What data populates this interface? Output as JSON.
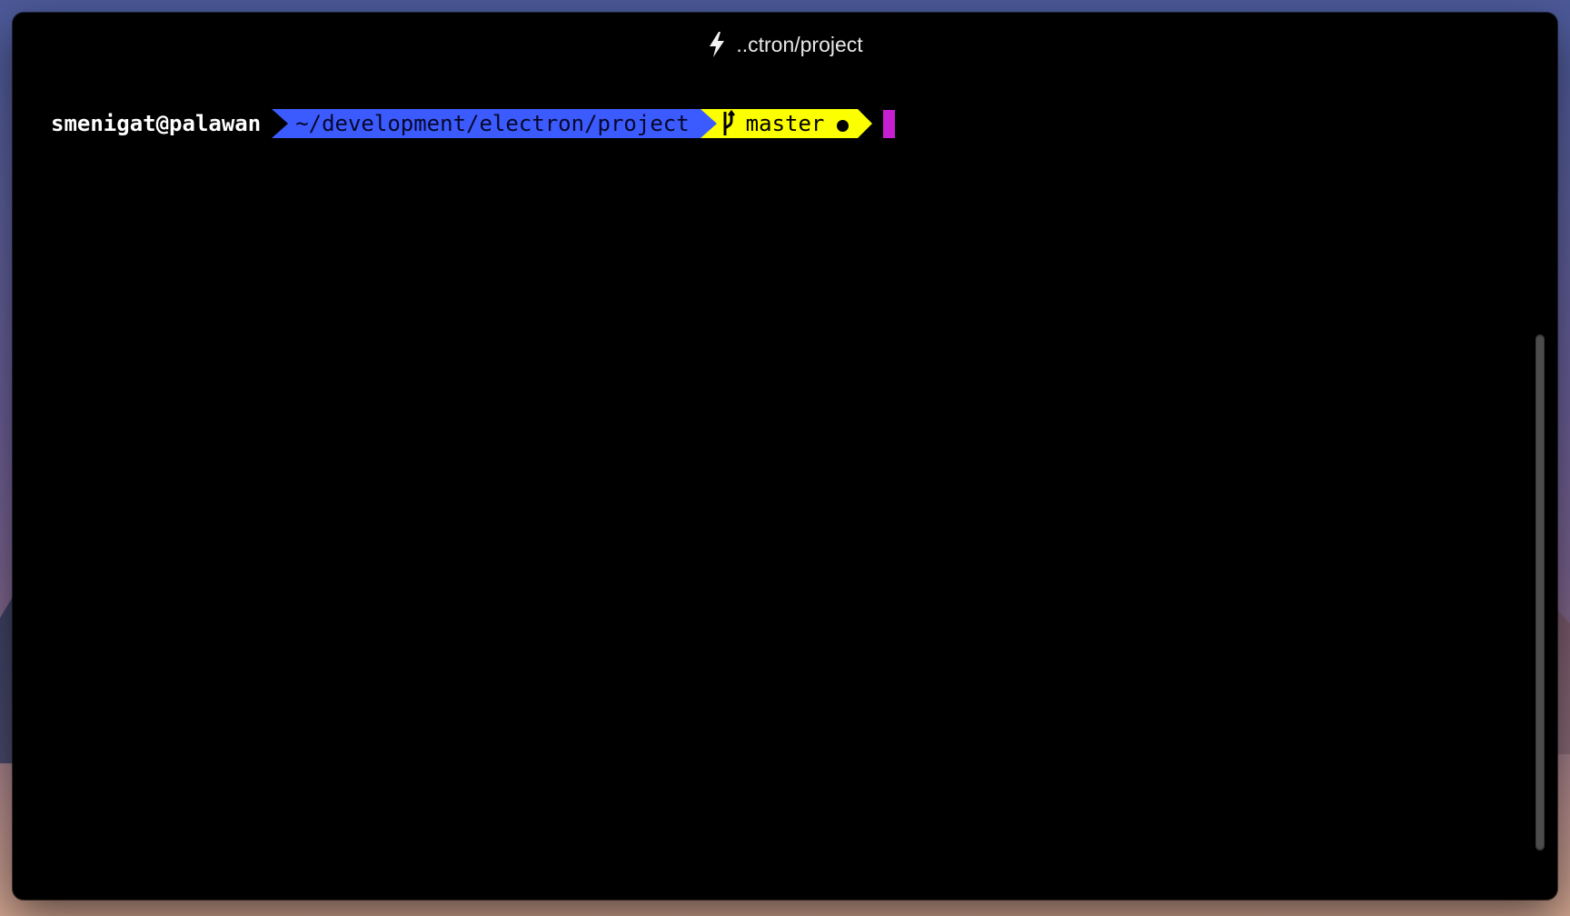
{
  "window": {
    "title": "..ctron/project",
    "title_icon": "bolt-icon"
  },
  "prompt": {
    "user_host": "smenigat@palawan",
    "path": "~/development/electron/project",
    "git_branch": "master",
    "git_branch_icon": "git-branch-icon",
    "git_dirty_indicator": "dirty-dot-icon"
  },
  "colors": {
    "terminal_background": "#000000",
    "path_segment": "#3c5bff",
    "git_segment": "#fbff00",
    "cursor": "#c61fd1",
    "title_text": "#e9e9e9",
    "user_text": "#ffffff"
  }
}
